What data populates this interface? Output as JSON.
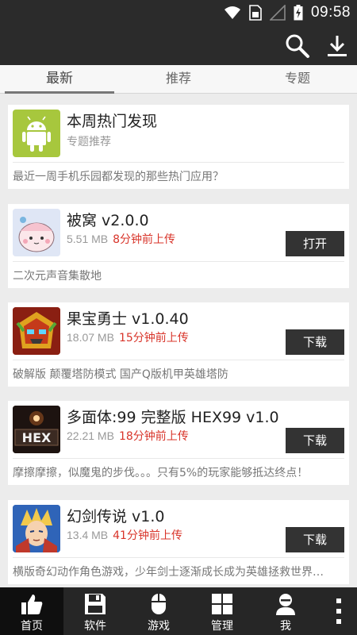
{
  "status_bar": {
    "time": "09:58"
  },
  "action_bar": {
    "search_icon": "search-icon",
    "download_icon": "download-icon"
  },
  "tabs": [
    {
      "label": "最新",
      "active": true
    },
    {
      "label": "推荐",
      "active": false
    },
    {
      "label": "专题",
      "active": false
    }
  ],
  "feature": {
    "title": "本周热门发现",
    "subtitle": "专题推荐",
    "description": "最近一周手机乐园都发现的那些热门应用？",
    "icon": "android-icon"
  },
  "apps": [
    {
      "title": "被窝 v2.0.0",
      "size": "5.51 MB",
      "time": "8分钟前上传",
      "action": "打开",
      "description": "二次元声音集散地",
      "icon": "beiwo-app-icon"
    },
    {
      "title": "果宝勇士 v1.0.40",
      "size": "18.07 MB",
      "time": "15分钟前上传",
      "action": "下载",
      "description": "破解版 颠覆塔防模式 国产Q版机甲英雄塔防",
      "icon": "guobao-app-icon"
    },
    {
      "title": "多面体:99  完整版  HEX99  v1.0",
      "size": "22.21 MB",
      "time": "18分钟前上传",
      "action": "下载",
      "description": "摩擦摩擦，似魔鬼的步伐。。。只有5%的玩家能够抵达终点！",
      "icon": "hex-app-icon",
      "icon_text": "HEX"
    },
    {
      "title": "幻剑传说  v1.0",
      "size": "13.4 MB",
      "time": "41分钟前上传",
      "action": "下载",
      "description": "横版奇幻动作角色游戏，少年剑士逐渐成长成为英雄拯救世界…",
      "icon": "huanjian-app-icon"
    }
  ],
  "bottom_nav": [
    {
      "label": "首页",
      "icon": "thumbs-up-icon",
      "active": true
    },
    {
      "label": "软件",
      "icon": "floppy-icon",
      "active": false
    },
    {
      "label": "游戏",
      "icon": "mouse-icon",
      "active": false
    },
    {
      "label": "管理",
      "icon": "grid-icon",
      "active": false
    },
    {
      "label": "我",
      "icon": "user-icon",
      "active": false
    }
  ],
  "colors": {
    "accent_red": "#d8342a",
    "bar_dark": "#2b2b2b"
  }
}
